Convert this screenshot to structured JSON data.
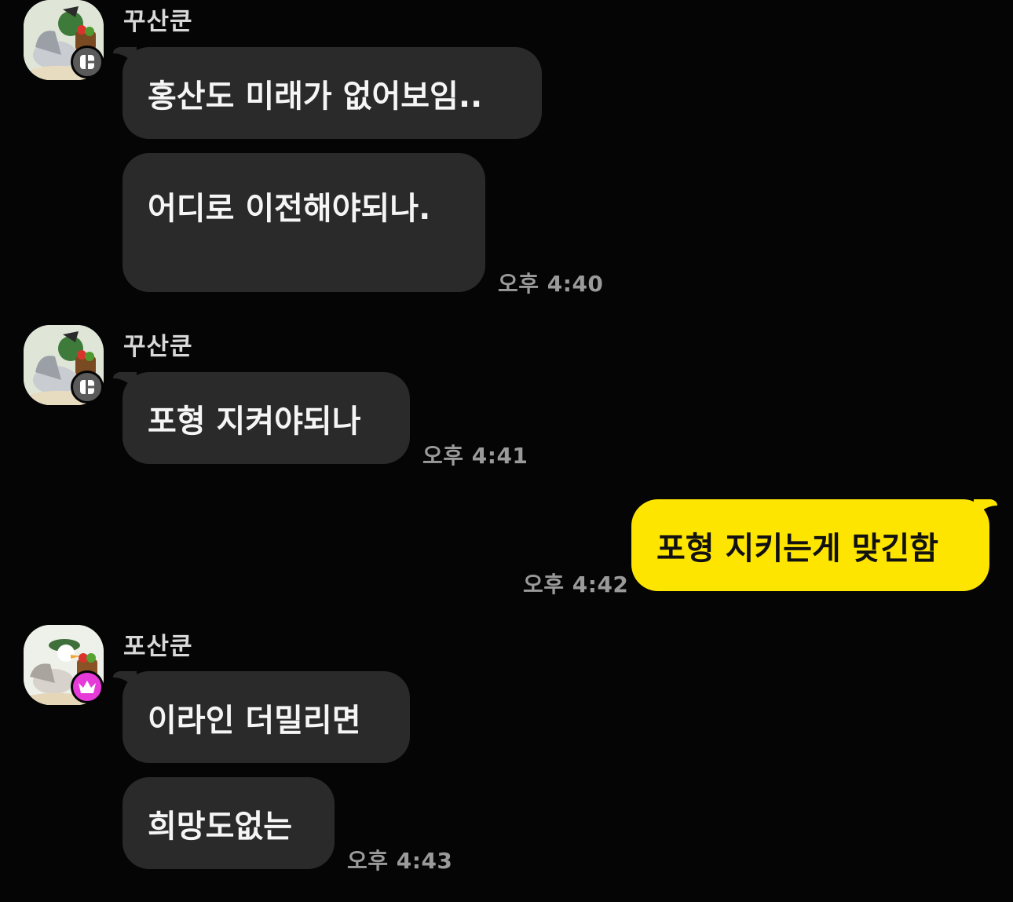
{
  "chat": {
    "groups": [
      {
        "sender": "꾸산쿤",
        "badge": "member",
        "messages": [
          "홍산도 미래가 없어보임..",
          "어디로 이전해야되나."
        ],
        "time": "오후 4:40"
      },
      {
        "sender": "꾸산쿤",
        "badge": "member",
        "messages": [
          "포형 지켜야되나"
        ],
        "time": "오후 4:41"
      },
      {
        "sender": "",
        "mine": true,
        "messages": [
          "포형 지키는게 맞긴함"
        ],
        "time": "오후 4:42"
      },
      {
        "sender": "포산쿤",
        "badge": "host",
        "messages": [
          "이라인 더밀리면",
          "희망도없는"
        ],
        "time": "오후 4:43"
      }
    ]
  },
  "colors": {
    "background": "#050505",
    "incoming_bubble": "#2a2a2a",
    "outgoing_bubble": "#fee500",
    "host_badge": "#e63ad9",
    "member_badge": "#5a5a5a"
  },
  "icons": {
    "member_badge": "member-badge-icon",
    "host_badge": "crown-icon"
  }
}
